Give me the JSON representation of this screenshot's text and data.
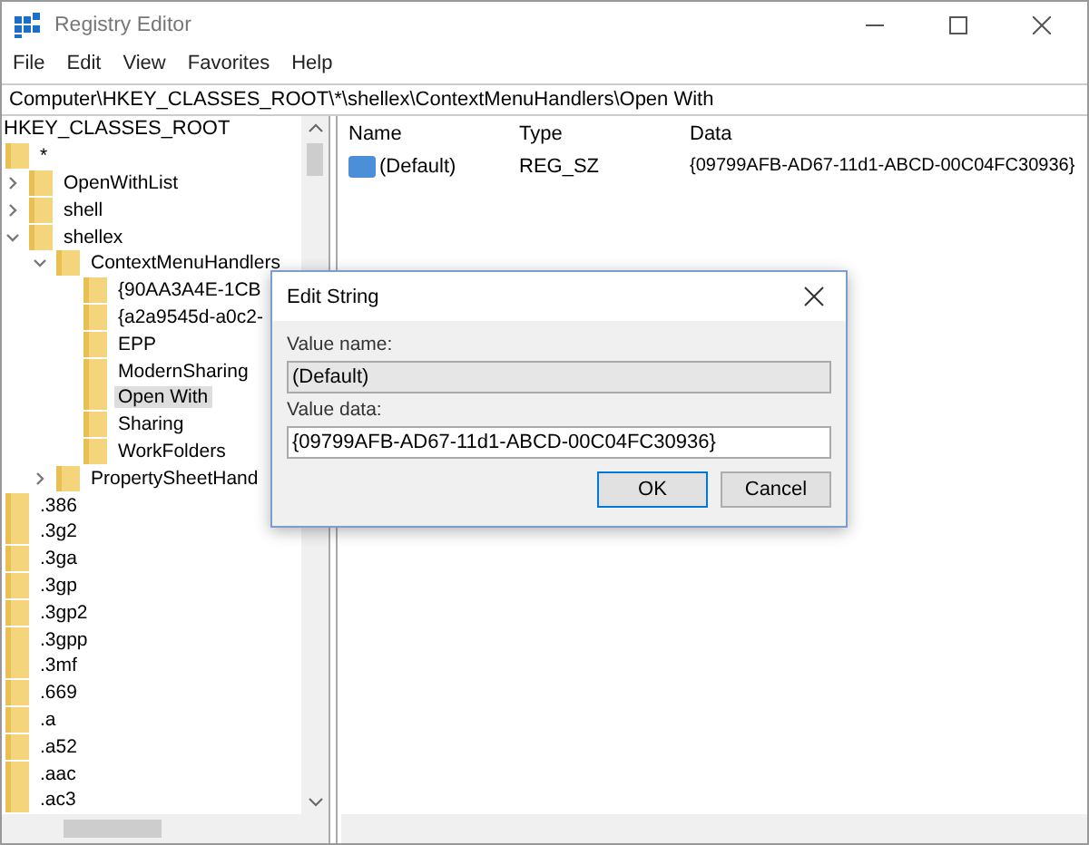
{
  "window": {
    "title": "Registry Editor"
  },
  "menu": [
    "File",
    "Edit",
    "View",
    "Favorites",
    "Help"
  ],
  "address": "Computer\\HKEY_CLASSES_ROOT\\*\\shellex\\ContextMenuHandlers\\Open With",
  "tree": {
    "root": "HKEY_CLASSES_ROOT",
    "items": [
      {
        "label": "*",
        "selected": false,
        "children": [
          {
            "label": "OpenWithList",
            "selected": false,
            "expanded": false
          },
          {
            "label": "shell",
            "selected": false,
            "expanded": false
          },
          {
            "label": "shellex",
            "selected": false,
            "expanded": true,
            "children": [
              {
                "label": "ContextMenuHandlers",
                "selected": false,
                "expanded": true,
                "children": [
                  {
                    "label": "{90AA3A4E-1CB",
                    "selected": false
                  },
                  {
                    "label": "{a2a9545d-a0c2-",
                    "selected": false
                  },
                  {
                    "label": "EPP",
                    "selected": false
                  },
                  {
                    "label": "ModernSharing",
                    "selected": false
                  },
                  {
                    "label": "Open With",
                    "selected": true
                  },
                  {
                    "label": "Sharing",
                    "selected": false
                  },
                  {
                    "label": "WorkFolders",
                    "selected": false
                  }
                ]
              },
              {
                "label": "PropertySheetHand",
                "selected": false,
                "expanded": false
              }
            ]
          }
        ]
      },
      {
        "label": ".386",
        "selected": false
      },
      {
        "label": ".3g2",
        "selected": false
      },
      {
        "label": ".3ga",
        "selected": false
      },
      {
        "label": ".3gp",
        "selected": false
      },
      {
        "label": ".3gp2",
        "selected": false
      },
      {
        "label": ".3gpp",
        "selected": false
      },
      {
        "label": ".3mf",
        "selected": false
      },
      {
        "label": ".669",
        "selected": false
      },
      {
        "label": ".a",
        "selected": false
      },
      {
        "label": ".a52",
        "selected": false
      },
      {
        "label": ".aac",
        "selected": false
      },
      {
        "label": ".ac3",
        "selected": false
      }
    ]
  },
  "values": {
    "columns": [
      "Name",
      "Type",
      "Data"
    ],
    "rows": [
      {
        "name": "(Default)",
        "type": "REG_SZ",
        "data": "{09799AFB-AD67-11d1-ABCD-00C04FC30936}"
      }
    ]
  },
  "dialog": {
    "title": "Edit String",
    "name_label": "Value name:",
    "name_value": "(Default)",
    "data_label": "Value data:",
    "data_value": "{09799AFB-AD67-11d1-ABCD-00C04FC30936}",
    "buttons": [
      "OK",
      "Cancel"
    ]
  }
}
